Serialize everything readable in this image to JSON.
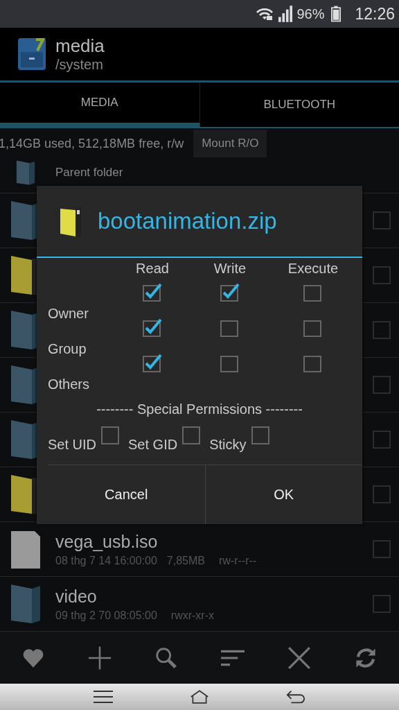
{
  "status_bar": {
    "battery": "96%",
    "time": "12:26"
  },
  "header": {
    "title": "media",
    "path": "/system"
  },
  "tabs": [
    {
      "label": "MEDIA",
      "selected": true
    },
    {
      "label": "BLUETOOTH",
      "selected": false
    }
  ],
  "storage": {
    "info": "1,14GB used, 512,18MB free, r/w",
    "button": "Mount R/O"
  },
  "files": [
    {
      "kind": "parent",
      "name": "Parent folder"
    },
    {
      "kind": "folder",
      "checked": false
    },
    {
      "kind": "zip",
      "checked": false
    },
    {
      "kind": "folder",
      "checked": false
    },
    {
      "kind": "folder",
      "checked": false
    },
    {
      "kind": "folder",
      "checked": false
    },
    {
      "kind": "zip",
      "checked": false
    },
    {
      "kind": "file",
      "name": "vega_usb.iso",
      "date": "08 thg 7 14 16:00:00",
      "size": "7,85MB",
      "perms": "rw-r--r--",
      "checked": false
    },
    {
      "kind": "folder",
      "name": "video",
      "date": "09 thg 2 70 08:05:00",
      "perms": "rwxr-xr-x",
      "checked": false
    }
  ],
  "dialog": {
    "title": "bootanimation.zip",
    "columns": [
      "Read",
      "Write",
      "Execute"
    ],
    "rows": [
      {
        "label": "Owner",
        "checks": [
          {
            "checked": true
          },
          {
            "checked": true
          },
          {
            "checked": false
          }
        ]
      },
      {
        "label": "Group",
        "checks": [
          {
            "checked": true
          },
          {
            "checked": false
          },
          {
            "checked": false
          }
        ]
      },
      {
        "label": "Others",
        "checks": [
          {
            "checked": true
          },
          {
            "checked": false
          },
          {
            "checked": false
          }
        ]
      }
    ],
    "special_heading": "-------- Special Permissions --------",
    "special": [
      {
        "label": "Set UID",
        "checked": false
      },
      {
        "label": "Set GID",
        "checked": false
      },
      {
        "label": "Sticky",
        "checked": false
      }
    ],
    "buttons": [
      "Cancel",
      "OK"
    ]
  }
}
